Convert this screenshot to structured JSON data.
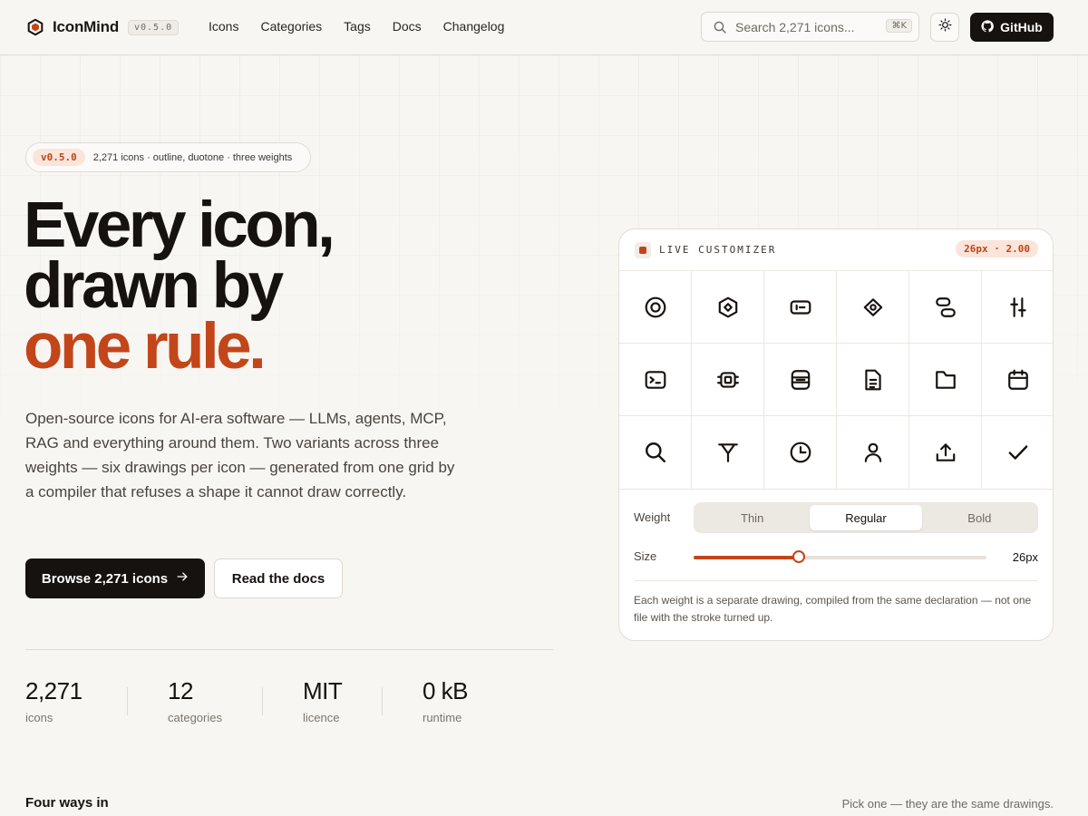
{
  "brand": {
    "name": "IconMind",
    "version": "v0.5.0",
    "logo_icon": "hexagon-logo-icon"
  },
  "nav": {
    "items": [
      "Icons",
      "Categories",
      "Tags",
      "Docs",
      "Changelog"
    ]
  },
  "search": {
    "placeholder": "Search 2,271 icons...",
    "shortcut": "⌘K",
    "icon": "search-icon"
  },
  "header": {
    "theme_icon": "sun-icon",
    "github_label": "GitHub",
    "github_icon": "github-icon"
  },
  "hero": {
    "pill_tag": "v0.5.0",
    "pill_text": "2,271 icons · outline, duotone · three weights",
    "headline_1": "Every icon,",
    "headline_2": "drawn by",
    "headline_3": "one rule.",
    "lede": "Open-source icons for AI-era software — LLMs, agents, MCP, RAG and everything around them. Two variants across three weights — six drawings per icon — generated from one grid by a compiler that refuses a shape it cannot draw correctly.",
    "primary_cta": "Browse 2,271 icons",
    "secondary_cta": "Read the docs"
  },
  "stats": [
    {
      "value": "2,271",
      "label": "icons"
    },
    {
      "value": "12",
      "label": "categories"
    },
    {
      "value": "MIT",
      "label": "licence"
    },
    {
      "value": "0 kB",
      "label": "runtime"
    }
  ],
  "customizer": {
    "title": "LIVE CUSTOMIZER",
    "badge": "26px · 2.00",
    "icons": [
      "target-icon",
      "hexagon-dot-icon",
      "token-icon",
      "diamond-eye-icon",
      "workflow-icon",
      "sliders-icon",
      "terminal-icon",
      "chip-icon",
      "database-icon",
      "document-icon",
      "folder-icon",
      "calendar-icon",
      "search-icon",
      "filter-icon",
      "clock-icon",
      "user-icon",
      "upload-icon",
      "check-icon"
    ],
    "weight_label": "Weight",
    "weights": [
      "Thin",
      "Regular",
      "Bold"
    ],
    "active_weight": "Regular",
    "size_label": "Size",
    "size_value": "26px",
    "size_fraction": 0.36,
    "note": "Each weight is a separate drawing, compiled from the same declaration — not one file with the stroke turned up."
  },
  "section": {
    "title": "Four ways in",
    "note": "Pick one — they are the same drawings."
  },
  "colors": {
    "accent": "#c2461a",
    "ink": "#16120f",
    "background": "#f8f6f3"
  }
}
